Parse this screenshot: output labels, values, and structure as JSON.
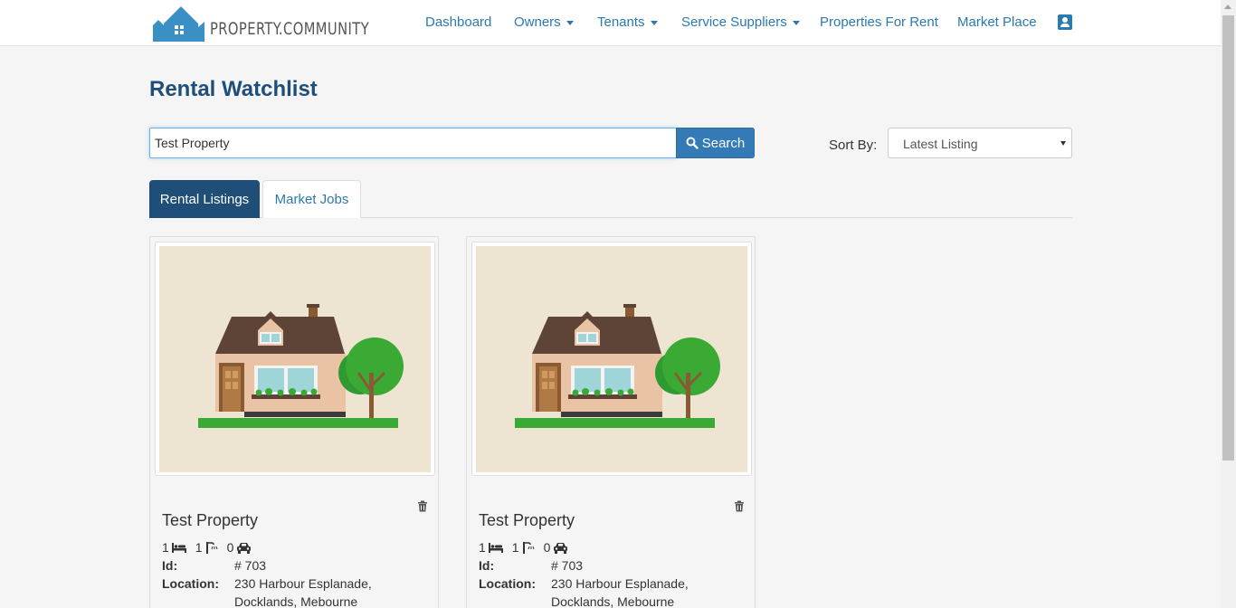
{
  "brand": {
    "name": "PROPERTY.COMMUNITY"
  },
  "nav": {
    "dashboard": "Dashboard",
    "owners": "Owners",
    "tenants": "Tenants",
    "service_suppliers": "Service Suppliers",
    "properties_for_rent": "Properties For Rent",
    "market_place": "Market Place"
  },
  "page": {
    "title": "Rental Watchlist"
  },
  "search": {
    "value": "Test Property",
    "button_label": "Search"
  },
  "sort": {
    "label": "Sort By:",
    "selected": "Latest Listing"
  },
  "tabs": [
    {
      "label": "Rental Listings",
      "active": true
    },
    {
      "label": "Market Jobs",
      "active": false
    }
  ],
  "listings": [
    {
      "title": "Test Property",
      "bedrooms": "1",
      "bathrooms": "1",
      "parking": "0",
      "id_label": "Id:",
      "id_value": "# 703",
      "location_label": "Location:",
      "location_line1": "230 Harbour Esplanade,",
      "location_line2": "Docklands, Mebourne"
    },
    {
      "title": "Test Property",
      "bedrooms": "1",
      "bathrooms": "1",
      "parking": "0",
      "id_label": "Id:",
      "id_value": "# 703",
      "location_label": "Location:",
      "location_line1": "230 Harbour Esplanade,",
      "location_line2": "Docklands, Mebourne"
    }
  ],
  "colors": {
    "brand_blue": "#337ab7",
    "title_navy": "#1f4e79",
    "link_blue": "#2a7ab0",
    "thumb_bg": "#ede5d2"
  },
  "icons": {
    "logo": "house-logo-icon",
    "profile": "contact-card-icon",
    "search": "magnifier-icon",
    "delete": "trash-icon",
    "bed": "bed-icon",
    "bath": "bath-icon",
    "car": "car-icon"
  }
}
